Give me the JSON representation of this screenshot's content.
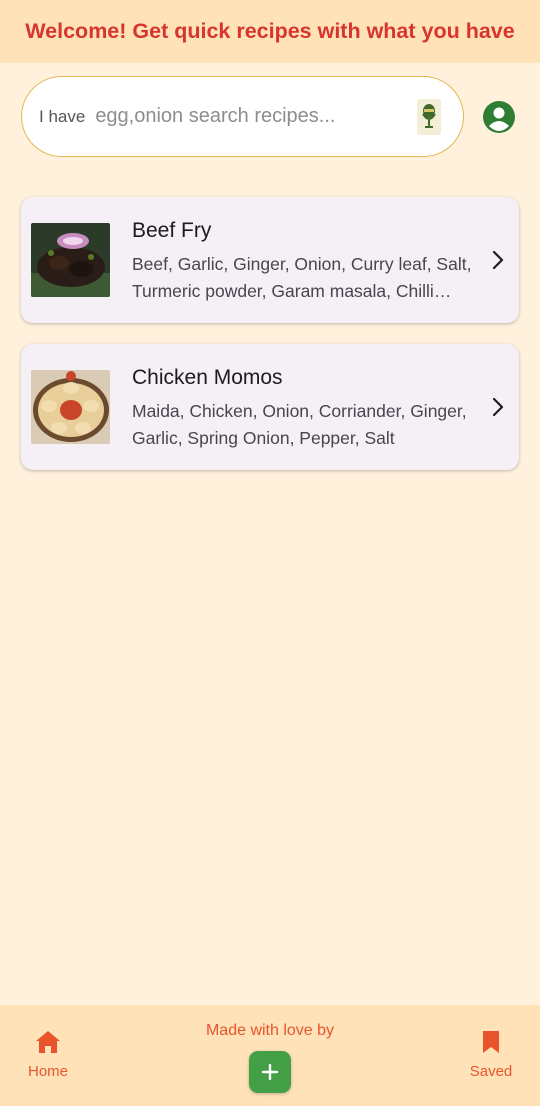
{
  "header": {
    "title": "Welcome! Get quick recipes with what you have"
  },
  "search": {
    "prefix": "I have",
    "placeholder": "egg,onion search recipes...",
    "mic_icon": "mic-icon"
  },
  "profile": {
    "icon": "account-circle-icon"
  },
  "recipes": [
    {
      "title": "Beef Fry",
      "ingredients": "Beef, Garlic, Ginger, Onion, Curry leaf, Salt, Turmeric powder, Garam masala, Chilli powder",
      "thumb_icon": "beef-fry-image"
    },
    {
      "title": "Chicken Momos",
      "ingredients": "Maida, Chicken, Onion, Corriander, Ginger, Garlic, Spring Onion, Pepper, Salt",
      "thumb_icon": "chicken-momos-image"
    }
  ],
  "bottom_nav": {
    "home_label": "Home",
    "made_with_label": "Made with love by",
    "saved_label": "Saved",
    "add_icon": "plus-icon"
  },
  "colors": {
    "background": "#fff1dc",
    "header_bg": "#ffe2b8",
    "title_red": "#d8352e",
    "accent_orange": "#e8552c",
    "green": "#43a047",
    "card_bg": "#f5eff6"
  }
}
